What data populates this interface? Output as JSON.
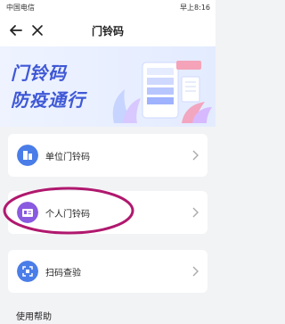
{
  "status": {
    "carrier": "中国电信",
    "signal_icon": "signal-icon",
    "right_icons": "",
    "time": "早上8:16"
  },
  "nav": {
    "title": "门铃码",
    "back_icon": "back-arrow-icon",
    "close_icon": "close-icon"
  },
  "banner": {
    "line1": "门铃码",
    "line2": "防疫通行"
  },
  "cards": [
    {
      "label": "单位门铃码",
      "icon": "building-icon",
      "icon_color": "#4a7de8"
    },
    {
      "label": "个人门铃码",
      "icon": "id-card-icon",
      "icon_color": "#8a5be0"
    },
    {
      "label": "扫码查验",
      "icon": "scan-icon",
      "icon_color": "#4a7de8"
    }
  ],
  "help": "使用帮助",
  "colors": {
    "accent": "#3f58d6",
    "highlight_ring": "#b0186e"
  }
}
